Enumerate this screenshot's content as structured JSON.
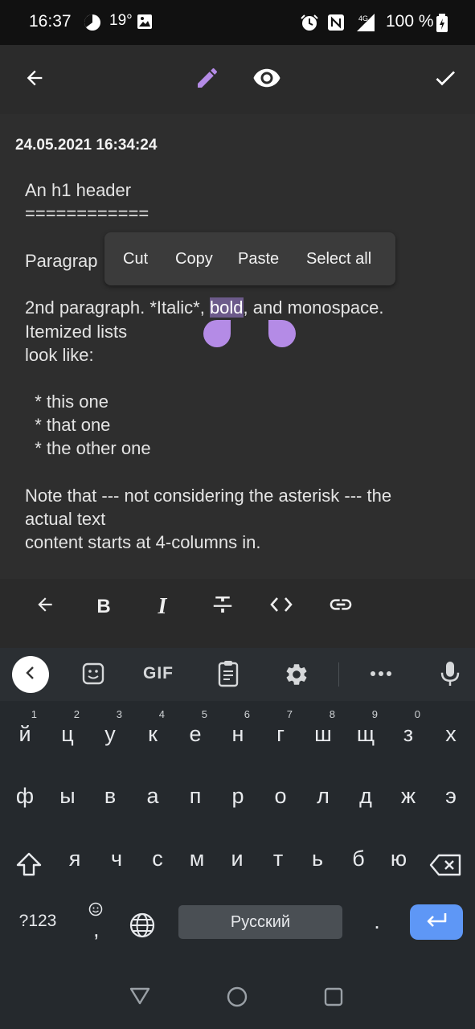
{
  "status_bar": {
    "time": "16:37",
    "temperature": "19°",
    "battery": "100 %",
    "network": "4G"
  },
  "app_bar": {
    "icons": [
      "back-arrow-icon",
      "pencil-icon",
      "eye-icon",
      "check-icon"
    ],
    "accent_color": "#b48be6"
  },
  "note": {
    "timestamp": "24.05.2021 16:34:24",
    "lines": [
      "An h1 header",
      "============",
      "Paragrap",
      "2nd paragraph. *Italic*, ",
      "bold",
      ", and monospace.",
      "Itemized lists",
      "look like:",
      "  * this one",
      "  * that one",
      "  * the other one",
      "Note that --- not considering the asterisk --- the",
      "actual text",
      "content starts at 4-columns in."
    ]
  },
  "context_menu": {
    "items": [
      "Cut",
      "Copy",
      "Paste",
      "Select all"
    ]
  },
  "format_toolbar": {
    "icons": [
      "undo-arrow-icon",
      "bold-icon",
      "italic-icon",
      "strikethrough-icon",
      "code-icon",
      "link-icon"
    ],
    "bold_label": "B",
    "italic_label": "I"
  },
  "keyboard": {
    "suggestion_icons": [
      "collapse-icon",
      "sticker-icon",
      "gif-icon",
      "clipboard-icon",
      "settings-icon",
      "more-icon",
      "mic-icon"
    ],
    "gif_label": "GIF",
    "row1": [
      "й",
      "ц",
      "у",
      "к",
      "е",
      "н",
      "г",
      "ш",
      "щ",
      "з",
      "х"
    ],
    "row1_hints": [
      "1",
      "2",
      "3",
      "4",
      "5",
      "6",
      "7",
      "8",
      "9",
      "0"
    ],
    "row2": [
      "ф",
      "ы",
      "в",
      "а",
      "п",
      "р",
      "о",
      "л",
      "д",
      "ж",
      "э"
    ],
    "row3": [
      "я",
      "ч",
      "с",
      "м",
      "и",
      "т",
      "ь",
      "б",
      "ю"
    ],
    "symbols_label": "?123",
    "comma_label": ",",
    "space_label": "Русский",
    "period_label": ".",
    "enter_color": "#5e97f6"
  },
  "nav_bar": {
    "icons": [
      "back-triangle-icon",
      "home-circle-icon",
      "recents-square-icon"
    ]
  }
}
